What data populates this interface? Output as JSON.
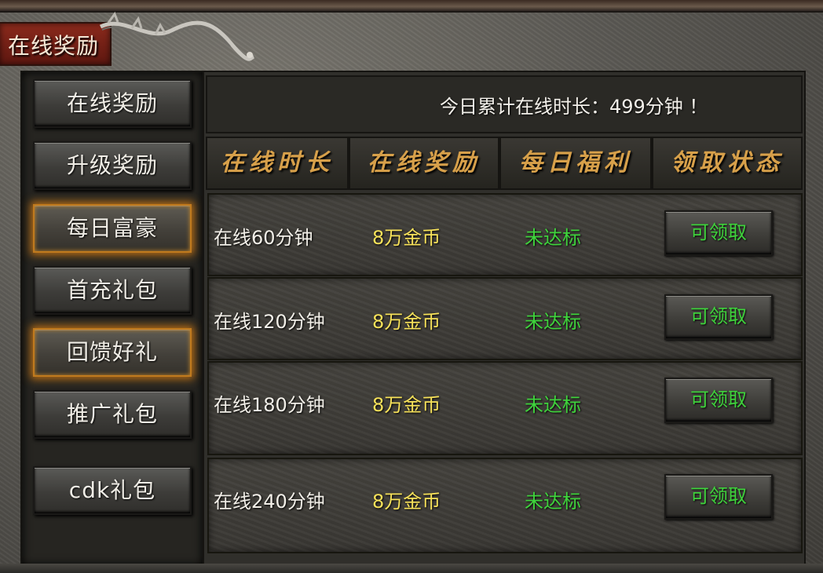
{
  "window": {
    "title": "在线奖励"
  },
  "sidebar": {
    "items": [
      {
        "label": "在线奖励"
      },
      {
        "label": "升级奖励"
      },
      {
        "label": "每日富豪"
      },
      {
        "label": "首充礼包"
      },
      {
        "label": "回馈好礼"
      },
      {
        "label": "推广礼包"
      },
      {
        "label": "cdk礼包"
      }
    ]
  },
  "summary": {
    "text": "今日累计在线时长：499分钟 ！"
  },
  "table": {
    "headers": [
      "在线时长",
      "在线奖励",
      "每日福利",
      "领取状态"
    ],
    "rows": [
      {
        "time": "在线60分钟",
        "reward": "8万金币",
        "status": "未达标",
        "button": "可领取"
      },
      {
        "time": "在线120分钟",
        "reward": "8万金币",
        "status": "未达标",
        "button": "可领取"
      },
      {
        "time": "在线180分钟",
        "reward": "8万金币",
        "status": "未达标",
        "button": "可领取"
      },
      {
        "time": "在线240分钟",
        "reward": "8万金币",
        "status": "未达标",
        "button": "可领取"
      }
    ]
  },
  "colors": {
    "reward": "#f7e25a",
    "status": "#3fd33c",
    "header": "#d7a04a",
    "glow": "#b86e16"
  }
}
